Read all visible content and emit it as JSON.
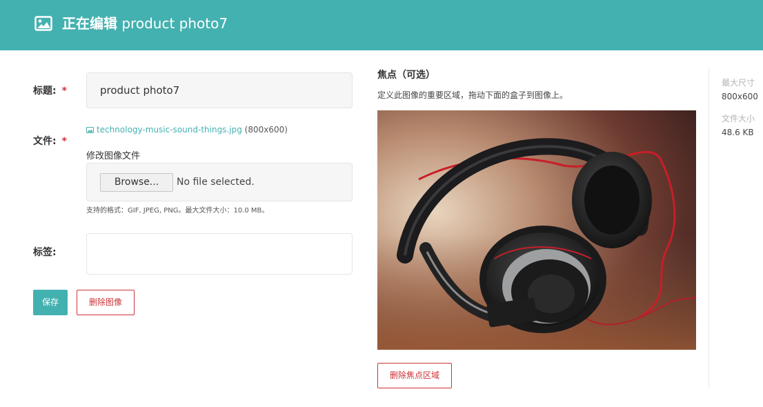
{
  "header": {
    "title_prefix": "正在编辑",
    "image_name": "product photo7",
    "icon": "image-icon",
    "bg_color": "#43b1b0"
  },
  "form": {
    "title_label": "标题:",
    "title_value": "product photo7",
    "required_mark": "*",
    "file_label": "文件:",
    "file_name": "technology-music-sound-things.jpg",
    "file_dimensions": "(800x600)",
    "change_image_label": "修改图像文件",
    "browse_label": "Browse...",
    "no_file_text": "No file selected.",
    "help_text": "支持的格式：GIF, JPEG, PNG。最大文件大小：10.0 MB。",
    "tags_label": "标签:",
    "tags_value": ""
  },
  "actions": {
    "save_label": "保存",
    "delete_image_label": "删除图像"
  },
  "focal": {
    "title": "焦点（可选）",
    "description": "定义此图像的重要区域，拖动下面的盒子到图像上。",
    "remove_label": "删除焦点区域"
  },
  "meta": {
    "max_size_label": "最大尺寸",
    "max_size_value": "800x600",
    "file_size_label": "文件大小",
    "file_size_value": "48.6 KB"
  },
  "colors": {
    "accent": "#43b1b0",
    "danger": "#cd3238"
  }
}
